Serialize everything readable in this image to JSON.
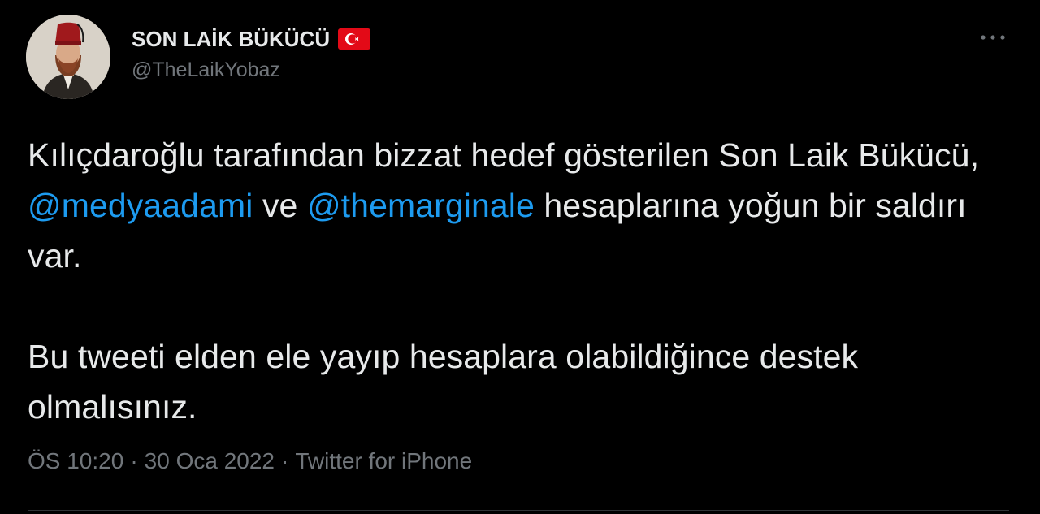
{
  "tweet": {
    "author": {
      "display_name": "SON LAİK BÜKÜCÜ",
      "handle": "@TheLaikYobaz",
      "avatar_icon": "profile-photo",
      "flag_icon": "turkey-flag-emoji"
    },
    "more_icon": "more-horizontal-icon",
    "text": {
      "paragraph1": {
        "part1": "Kılıçdaroğlu tarafından bizzat hedef gösterilen Son Laik Bükücü, ",
        "mention1": "@medyaadami",
        "part2": " ve ",
        "mention2": "@themarginale",
        "part3": " hesaplarına yoğun bir saldırı var."
      },
      "paragraph2": "Bu tweeti elden ele yayıp hesaplara olabildiğince destek olmalısınız."
    },
    "meta": {
      "time": "ÖS 10:20",
      "separator": "·",
      "date": "30 Oca 2022",
      "source": "Twitter for iPhone"
    }
  },
  "colors": {
    "background": "#000000",
    "text": "#e7e9ea",
    "secondary_text": "#71767b",
    "link": "#1d9bf0",
    "flag_red": "#e30a17"
  }
}
